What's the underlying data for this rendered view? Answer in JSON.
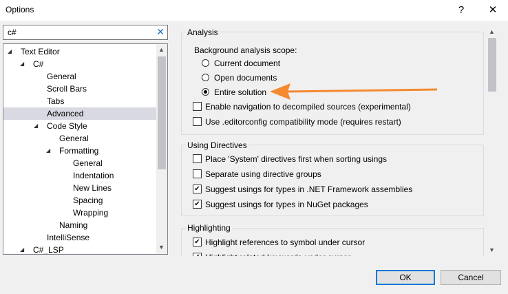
{
  "window": {
    "title": "Options",
    "help_glyph": "?",
    "close_glyph": "✕"
  },
  "search": {
    "value": "c#",
    "clear_glyph": "✕"
  },
  "tree": [
    {
      "label": "Text Editor",
      "indent": 0,
      "expanded": true
    },
    {
      "label": "C#",
      "indent": 1,
      "expanded": true
    },
    {
      "label": "General",
      "indent": 2
    },
    {
      "label": "Scroll Bars",
      "indent": 2
    },
    {
      "label": "Tabs",
      "indent": 2
    },
    {
      "label": "Advanced",
      "indent": 2,
      "selected": true
    },
    {
      "label": "Code Style",
      "indent": 2,
      "expanded": true
    },
    {
      "label": "General",
      "indent": 3
    },
    {
      "label": "Formatting",
      "indent": 3,
      "expanded": true
    },
    {
      "label": "General",
      "indent": 4
    },
    {
      "label": "Indentation",
      "indent": 4
    },
    {
      "label": "New Lines",
      "indent": 4
    },
    {
      "label": "Spacing",
      "indent": 4
    },
    {
      "label": "Wrapping",
      "indent": 4
    },
    {
      "label": "Naming",
      "indent": 3
    },
    {
      "label": "IntelliSense",
      "indent": 2
    },
    {
      "label": "C#_LSP",
      "indent": 1,
      "expanded": true
    }
  ],
  "analysis": {
    "title": "Analysis",
    "scope_label": "Background analysis scope:",
    "scope_options": [
      {
        "label": "Current document",
        "checked": false
      },
      {
        "label": "Open documents",
        "checked": false
      },
      {
        "label": "Entire solution",
        "checked": true
      }
    ],
    "checkboxes": [
      {
        "label": "Enable navigation to decompiled sources (experimental)",
        "checked": false
      },
      {
        "label": "Use .editorconfig compatibility mode (requires restart)",
        "checked": false
      }
    ]
  },
  "using_directives": {
    "title": "Using Directives",
    "checkboxes": [
      {
        "label": "Place 'System' directives first when sorting usings",
        "checked": false
      },
      {
        "label": "Separate using directive groups",
        "checked": false
      },
      {
        "label": "Suggest usings for types in .NET Framework assemblies",
        "checked": true
      },
      {
        "label": "Suggest usings for types in NuGet packages",
        "checked": true
      }
    ]
  },
  "highlighting": {
    "title": "Highlighting",
    "checkboxes": [
      {
        "label": "Highlight references to symbol under cursor",
        "checked": true
      },
      {
        "label": "Highlight related keywords under cursor",
        "checked": true
      }
    ]
  },
  "colors": {
    "arrow": "#f4892f",
    "selection": "#d9d9e4",
    "default_button_border": "#0078d7"
  },
  "buttons": {
    "ok": "OK",
    "cancel": "Cancel"
  }
}
